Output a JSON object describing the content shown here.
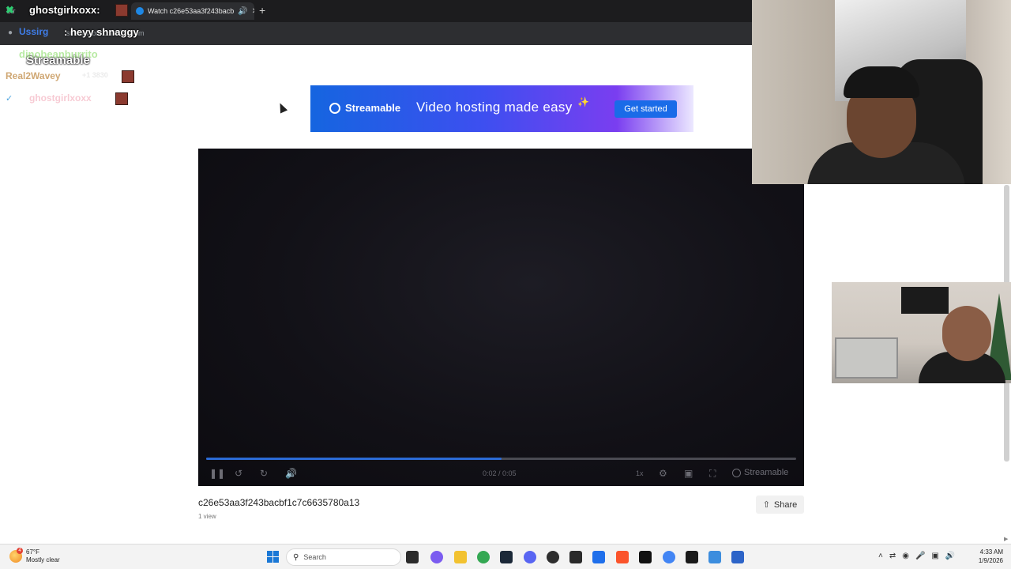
{
  "browser": {
    "tabs": [
      {
        "label": "Str"
      },
      {
        "label": "Watch c26e53aa3f243bacb"
      }
    ],
    "address": "streamable.com/893vpm"
  },
  "banner": {
    "brand": "Streamable",
    "tagline": "Video hosting made easy",
    "cta": "Get started"
  },
  "player": {
    "time": "0:02 / 0:05",
    "speed": "1x",
    "brand": "Streamable",
    "progress": 0.5
  },
  "video": {
    "title": "c26e53aa3f243bacbf1c7c6635780a13",
    "views": "1 view",
    "share": "Share"
  },
  "chat": {
    "lines": [
      {
        "user": "ghostgirlxoxx:",
        "message": ""
      },
      {
        "user": "Ussirg",
        "message": ": heyy shnaggy"
      },
      {
        "user": "dinobeanburrito",
        "message": ""
      },
      {
        "user": "Real2Wavey",
        "message": "+1 3830"
      },
      {
        "user": "ghostgirlxoxx",
        "message": ""
      }
    ],
    "overlay_brand": "Streamable"
  },
  "taskbar": {
    "weather_temp": "67°F",
    "weather_desc": "Mostly clear",
    "weather_badge": "4",
    "search_placeholder": "Search",
    "time": "4:33 AM",
    "date": "1/9/2026"
  },
  "colors": {
    "accent": "#1a6be8",
    "player_bg": "#121117",
    "progress": "#2b6bd6"
  }
}
